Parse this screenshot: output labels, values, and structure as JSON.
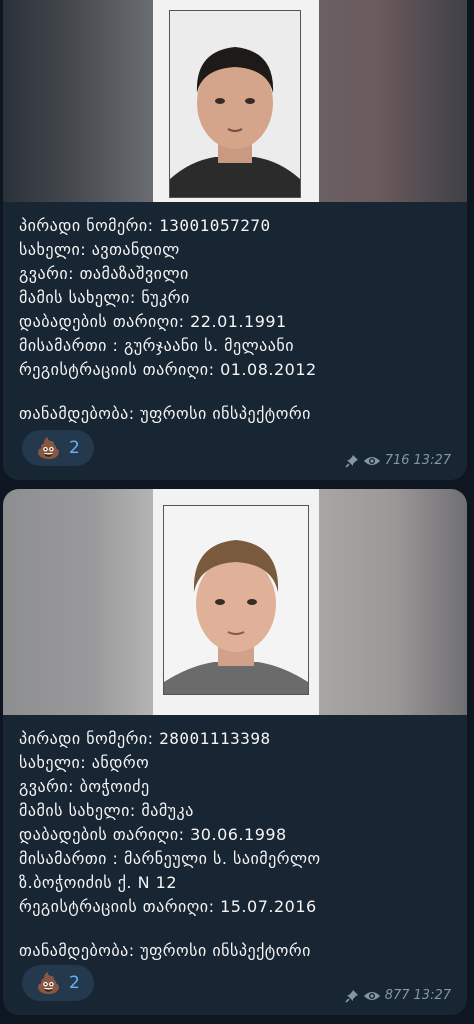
{
  "posts": [
    {
      "personal_number": {
        "label": "პირადი ნომერი: ",
        "value": "13001057270"
      },
      "first_name": "სახელი: ავთანდილ",
      "last_name": "გვარი: თამაზაშვილი",
      "father_name": "მამის სახელი: ნუკრი",
      "birth_date": "დაბადების თარიღი: 22.01.1991",
      "address": [
        "მისამართი : გურჯაანი ს. მელაანი"
      ],
      "registration_date": "რეგისტრაციის თარიღი: 01.08.2012",
      "position": "თანამდებობა: უფროსი ინსპექტორი",
      "reaction": {
        "emoji": "💩",
        "count": "2"
      },
      "views": "716",
      "time": "13:27",
      "icons": [
        "pin-icon",
        "eye-icon"
      ]
    },
    {
      "personal_number": {
        "label": "პირადი ნომერი: ",
        "value": "28001113398"
      },
      "first_name": "სახელი: ანდრო",
      "last_name": "გვარი: ბოჭოიძე",
      "father_name": "მამის სახელი: მამუკა",
      "birth_date": "დაბადების თარიღი: 30.06.1998",
      "address": [
        "მისამართი : მარნეული ს. საიმერლო",
        "ზ.ბოჭოიძის ქ. N 12"
      ],
      "registration_date": "რეგისტრაციის თარიღი: 15.07.2016",
      "position": "თანამდებობა: უფროსი ინსპექტორი",
      "reaction": {
        "emoji": "💩",
        "count": "2"
      },
      "views": "877",
      "time": "13:27",
      "icons": [
        "pin-icon",
        "eye-icon"
      ]
    }
  ],
  "colors": {
    "background": "#0e1621",
    "bubble": "#182533",
    "reaction_bg": "#24384e",
    "accent": "#6ab3f3",
    "meta": "#8397a8"
  }
}
